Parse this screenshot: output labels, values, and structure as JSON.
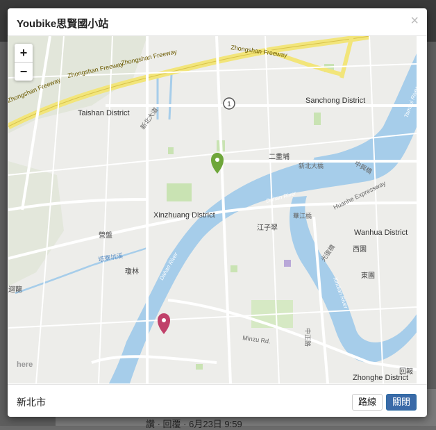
{
  "modal": {
    "title": "Youbike思賢國小站",
    "close_symbol": "×",
    "footer_city": "新北市",
    "route_label": "路線",
    "close_label": "關閉"
  },
  "map": {
    "zoom_in": "+",
    "zoom_out": "−",
    "districts": [
      "Taishan District",
      "Sanchong District",
      "Xinzhuang District",
      "Wanhua District",
      "Zhonghe District"
    ],
    "places": [
      "二重埔",
      "江子翠",
      "西園",
      "東園",
      "營盤",
      "瓊林",
      "迴龍",
      "回報",
      "here"
    ],
    "roads": [
      "Zhongshan Freeway",
      "Minzu Rd.",
      "Huanhe Expressway",
      "新北大橋",
      "華江橋",
      "光復橋",
      "中興橋",
      "中正路",
      "新北大道"
    ],
    "rivers": [
      "Dahan River",
      "Xindian River",
      "Tamsui River",
      "塔寮坑溪"
    ],
    "route_shield": "1",
    "markers": [
      {
        "name": "green",
        "color": "#6ea63a"
      },
      {
        "name": "red",
        "color": "#c0416a"
      }
    ]
  },
  "background": {
    "footer_text": "讚 · 回覆 · 6月23日 9:59"
  }
}
